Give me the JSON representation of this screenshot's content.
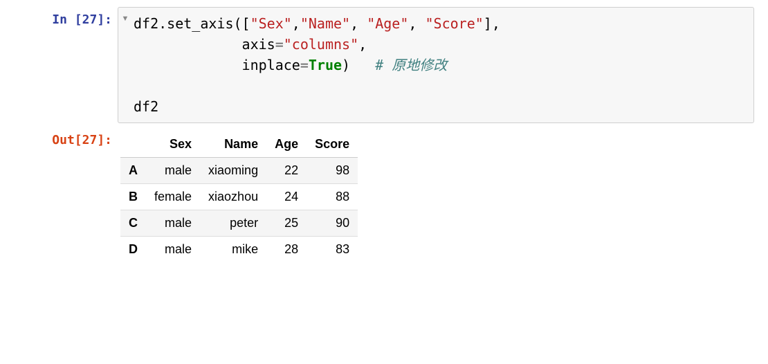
{
  "input": {
    "prompt": "In [27]:",
    "code_line1_a": "df2.set_axis([",
    "code_line1_s1": "\"Sex\"",
    "code_line1_c1": ",",
    "code_line1_s2": "\"Name\"",
    "code_line1_c2": ", ",
    "code_line1_s3": "\"Age\"",
    "code_line1_c3": ", ",
    "code_line1_s4": "\"Score\"",
    "code_line1_b": "],",
    "code_line2_a": "             axis",
    "code_line2_eq": "=",
    "code_line2_s": "\"columns\"",
    "code_line2_b": ",",
    "code_line3_a": "             inplace",
    "code_line3_eq": "=",
    "code_line3_kw": "True",
    "code_line3_b": ")   ",
    "code_line3_cmt": "# 原地修改",
    "code_line5": "df2"
  },
  "output": {
    "prompt": "Out[27]:",
    "columns": [
      "Sex",
      "Name",
      "Age",
      "Score"
    ],
    "index": [
      "A",
      "B",
      "C",
      "D"
    ],
    "rows": [
      [
        "male",
        "xiaoming",
        "22",
        "98"
      ],
      [
        "female",
        "xiaozhou",
        "24",
        "88"
      ],
      [
        "male",
        "peter",
        "25",
        "90"
      ],
      [
        "male",
        "mike",
        "28",
        "83"
      ]
    ]
  }
}
